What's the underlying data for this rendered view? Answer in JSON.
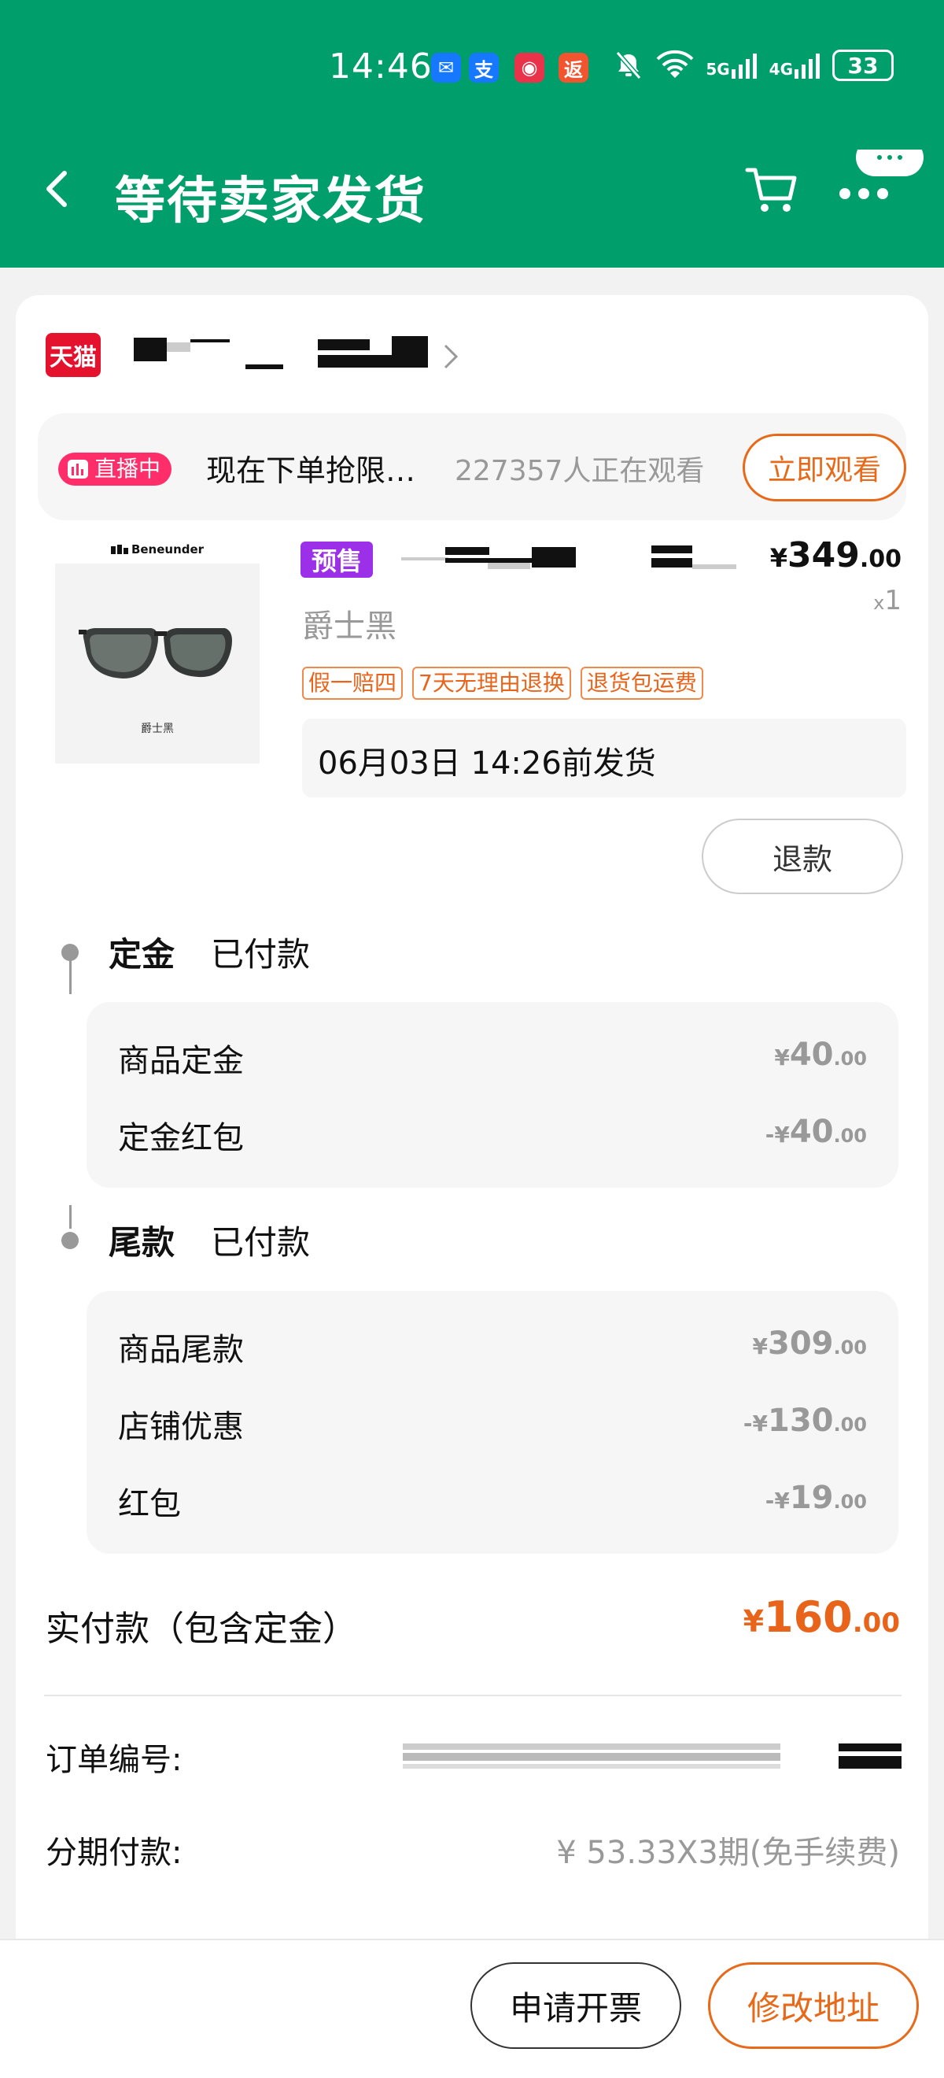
{
  "status_bar": {
    "time": "14:46",
    "network_5g": "5G",
    "network_4g": "4G",
    "battery": "33"
  },
  "nav": {
    "title": "等待卖家发货",
    "back_icon": "chevron-left-icon",
    "cart_icon": "cart-icon",
    "more_icon": "more-icon"
  },
  "shop": {
    "platform_logo": "天猫"
  },
  "live": {
    "badge": "直播中",
    "text": "现在下单抢限…",
    "viewers": "227357人正在观看",
    "watch_button": "立即观看"
  },
  "product": {
    "brand": "Beneunder",
    "image_color_label": "爵士黑",
    "presale_badge": "预售",
    "price_currency": "¥",
    "price_int": "349",
    "price_dec": ".00",
    "qty_prefix": "x",
    "qty": "1",
    "sku": "爵士黑",
    "tags": [
      "假一赔四",
      "7天无理由退换",
      "退货包运费"
    ],
    "ship_text": "06月03日 14:26前发货",
    "refund_button": "退款"
  },
  "deposit": {
    "title": "定金",
    "status": "已付款",
    "rows": [
      {
        "label": "商品定金",
        "cur": "¥",
        "int": "40",
        "dec": ".00"
      },
      {
        "label": "定金红包",
        "cur": "-¥",
        "int": "40",
        "dec": ".00"
      }
    ]
  },
  "balance": {
    "title": "尾款",
    "status": "已付款",
    "rows": [
      {
        "label": "商品尾款",
        "cur": "¥",
        "int": "309",
        "dec": ".00"
      },
      {
        "label": "店铺优惠",
        "cur": "-¥",
        "int": "130",
        "dec": ".00"
      },
      {
        "label": "红包",
        "cur": "-¥",
        "int": "19",
        "dec": ".00"
      }
    ]
  },
  "paid": {
    "label": "实付款（包含定金）",
    "cur": "¥",
    "int": "160",
    "dec": ".00"
  },
  "info": {
    "order_no_label": "订单编号:",
    "installment_label": "分期付款:",
    "installment_value": "¥ 53.33X3期(免手续费)"
  },
  "bottom": {
    "invoice_button": "申请开票",
    "address_button": "修改地址"
  }
}
